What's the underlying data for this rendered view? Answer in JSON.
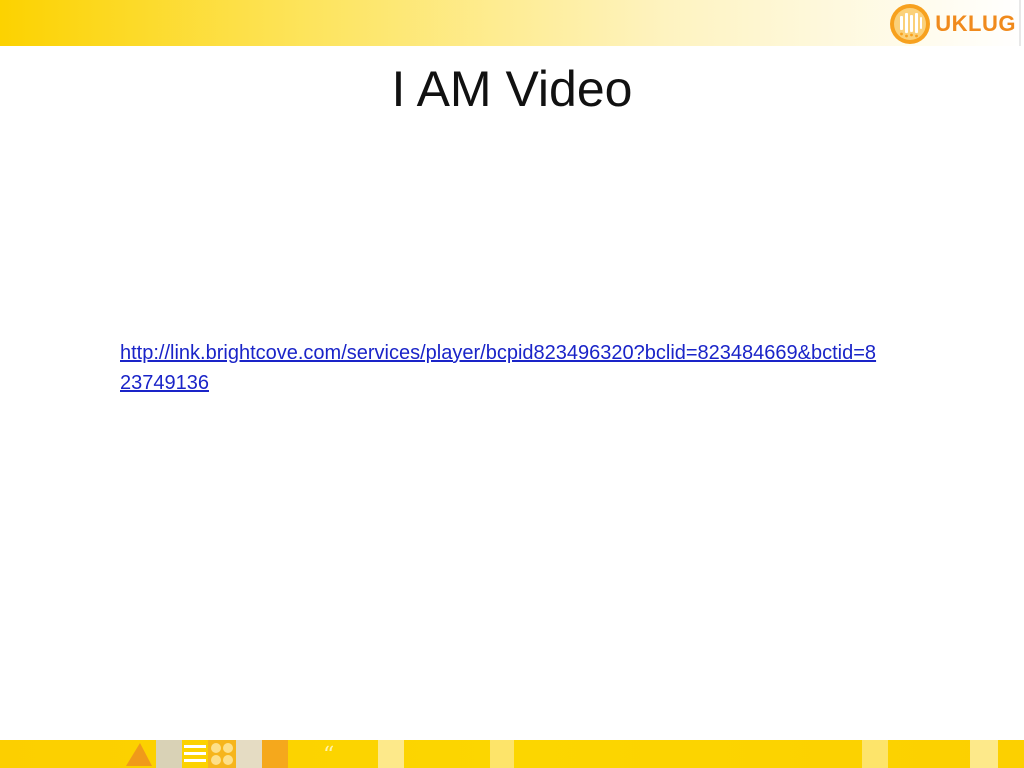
{
  "slide": {
    "title": "I AM Video",
    "link_text": "http://link.brightcove.com/services/player/bcpid823496320?bclid=823484669&bctid=823749136"
  },
  "logo": {
    "text": "UKLUG",
    "icon": "uklug-logo-icon"
  },
  "colors": {
    "band_yellow": "#fcd200",
    "logo_orange": "#f08a1c",
    "link_blue": "#1a24c8",
    "title_black": "#111111"
  }
}
